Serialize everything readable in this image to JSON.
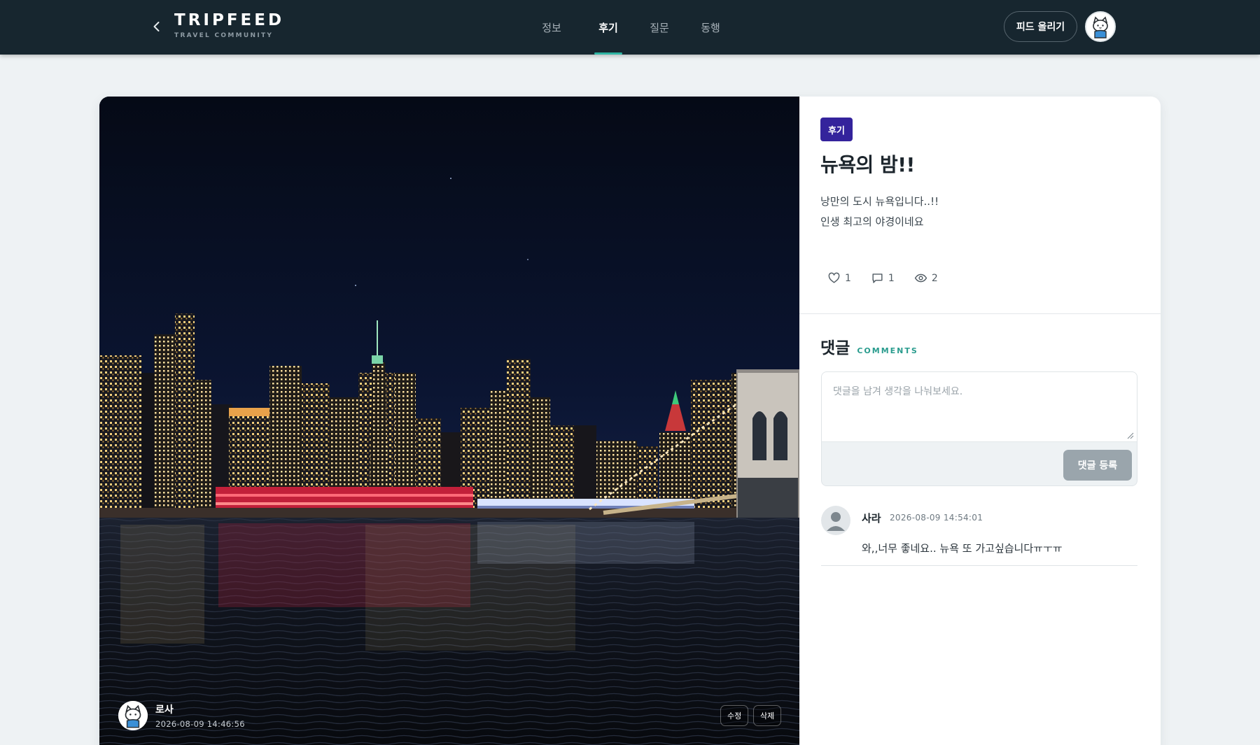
{
  "header": {
    "logo_name": "TRIPFEED",
    "logo_sub": "TRAVEL COMMUNITY",
    "nav": [
      {
        "label": "정보",
        "active": false
      },
      {
        "label": "후기",
        "active": true
      },
      {
        "label": "질문",
        "active": false
      },
      {
        "label": "동행",
        "active": false
      }
    ],
    "post_button": "피드 올리기"
  },
  "post": {
    "author": "로사",
    "created_at": "2026-08-09 14:46:56",
    "edit_label": "수정",
    "delete_label": "삭제",
    "category": "후기",
    "title": "뉴욕의 밤!!",
    "body_lines": [
      "낭만의 도시 뉴욕입니다..!!",
      "인생 최고의 야경이네요"
    ],
    "likes": "1",
    "comments": "1",
    "views": "2"
  },
  "comments_section": {
    "title": "댓글",
    "subtitle": "COMMENTS",
    "placeholder": "댓글을 남겨 생각을 나눠보세요.",
    "submit_label": "댓글 등록",
    "items": [
      {
        "author": "사라",
        "date": "2026-08-09 14:54:01",
        "text": "와,,너무 좋네요.. 뉴욕 또 가고싶습니다ㅠㅜㅠ"
      }
    ]
  },
  "colors": {
    "header_bg": "#17262f",
    "accent": "#2fb5a3",
    "badge": "#34239c",
    "submit_disabled": "#9aa5ac"
  },
  "icons": [
    "chevron-left-icon",
    "heart-icon",
    "comment-bubble-icon",
    "eye-icon",
    "user-silhouette-icon",
    "cat-avatar-icon"
  ]
}
